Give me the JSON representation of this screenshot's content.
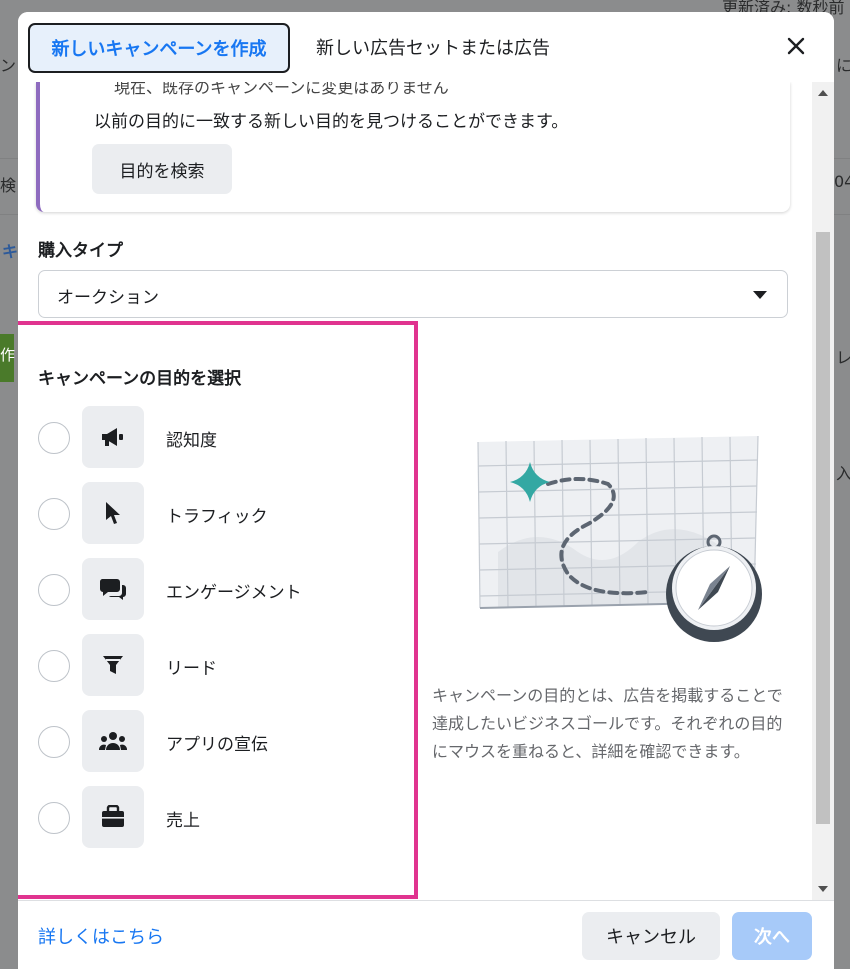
{
  "background": {
    "top_right_text": "更新済み: 数秒前",
    "left_fragment_1": "ン",
    "left_fragment_2": "検",
    "left_fragment_3": "キ",
    "left_fragment_4": "作",
    "right_fragment_1": "に",
    "right_fragment_2": "04",
    "right_fragment_3": "レ",
    "right_fragment_4": "入"
  },
  "tabs": {
    "active": "新しいキャンペーンを作成",
    "inactive": "新しい広告セットまたは広告",
    "close_icon": "close-icon"
  },
  "info_card": {
    "clipped_line": "現在、既存のキャンペーンに変更はありません",
    "line": "以前の目的に一致する新しい目的を見つけることができます。",
    "find_button": "目的を検索"
  },
  "purchase_type": {
    "label": "購入タイプ",
    "value": "オークション"
  },
  "objectives": {
    "title": "キャンペーンの目的を選択",
    "items": [
      {
        "label": "認知度",
        "icon": "megaphone-icon"
      },
      {
        "label": "トラフィック",
        "icon": "cursor-icon"
      },
      {
        "label": "エンゲージメント",
        "icon": "chat-bubbles-icon"
      },
      {
        "label": "リード",
        "icon": "funnel-icon"
      },
      {
        "label": "アプリの宣伝",
        "icon": "people-icon"
      },
      {
        "label": "売上",
        "icon": "briefcase-icon"
      }
    ]
  },
  "description": "キャンペーンの目的とは、広告を掲載することで達成したいビジネスゴールです。それぞれの目的にマウスを重ねると、詳細を確認できます。",
  "footer": {
    "learn_more": "詳しくはこちら",
    "cancel": "キャンセル",
    "next": "次へ"
  },
  "colors": {
    "accent": "#1877f2",
    "highlight": "#e0338f",
    "info_border": "#8e6bbf",
    "next_disabled": "#a7caf9"
  }
}
